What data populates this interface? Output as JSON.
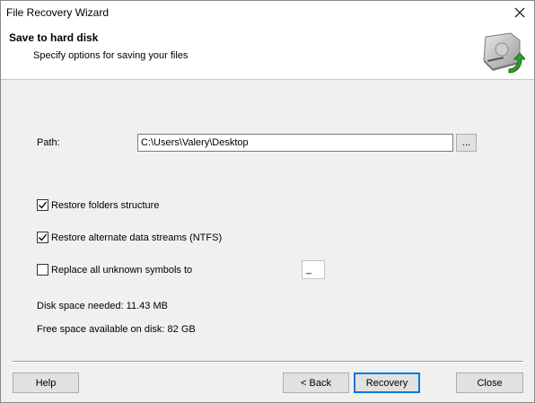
{
  "window": {
    "title": "File Recovery Wizard"
  },
  "header": {
    "title": "Save to hard disk",
    "subtitle": "Specify options for saving your files"
  },
  "path": {
    "label": "Path:",
    "value": "C:\\Users\\Valery\\Desktop",
    "browse_label": "..."
  },
  "options": {
    "restore_folders": {
      "label": "Restore folders structure",
      "checked": true
    },
    "restore_streams": {
      "label": "Restore alternate data streams (NTFS)",
      "checked": true
    },
    "replace_symbols": {
      "label": "Replace all unknown symbols to",
      "checked": false,
      "symbol": "_"
    }
  },
  "info": {
    "disk_needed": "Disk space needed: 11.43 MB",
    "free_space": "Free space available on disk: 82 GB"
  },
  "buttons": {
    "help": "Help",
    "back": "< Back",
    "recovery": "Recovery",
    "close": "Close"
  },
  "icons": {
    "close": "close-icon",
    "header": "hard-disk-save-icon",
    "check": "checkmark-icon"
  },
  "colors": {
    "accent": "#0078d7",
    "arrow": "#2e9e2e"
  }
}
